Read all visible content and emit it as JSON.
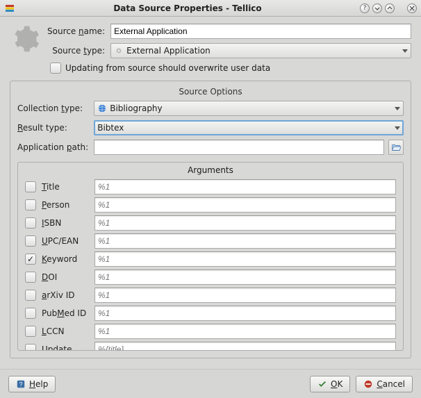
{
  "window": {
    "title": "Data Source Properties - Tellico"
  },
  "form": {
    "source_name": {
      "label": "Source name:",
      "access": "n",
      "value": "External Application"
    },
    "source_type": {
      "label": "Source type:",
      "access": "t",
      "value": "External Application"
    },
    "overwrite": {
      "label": "Updating from source should overwrite user data",
      "checked": false
    }
  },
  "options": {
    "title": "Source Options",
    "collection_type": {
      "label": "Collection type:",
      "access": "t",
      "value": "Bibliography"
    },
    "result_type": {
      "label": "Result type:",
      "access": "R",
      "value": "Bibtex"
    },
    "application_path": {
      "label": "Application path:",
      "access": "p",
      "value": ""
    }
  },
  "arguments": {
    "title": "Arguments",
    "rows": [
      {
        "label": "Title",
        "access": "T",
        "placeholder": "%1",
        "checked": false
      },
      {
        "label": "Person",
        "access": "P",
        "placeholder": "%1",
        "checked": false
      },
      {
        "label": "ISBN",
        "access": "I",
        "placeholder": "%1",
        "checked": false
      },
      {
        "label": "UPC/EAN",
        "access": "U",
        "placeholder": "%1",
        "checked": false
      },
      {
        "label": "Keyword",
        "access": "K",
        "placeholder": "%1",
        "checked": true
      },
      {
        "label": "DOI",
        "access": "D",
        "placeholder": "%1",
        "checked": false
      },
      {
        "label": "arXiv ID",
        "access": "a",
        "placeholder": "%1",
        "checked": false
      },
      {
        "label": "PubMed ID",
        "access": "M",
        "placeholder": "%1",
        "checked": false
      },
      {
        "label": "LCCN",
        "access": "L",
        "placeholder": "%1",
        "checked": false
      },
      {
        "label": "Update",
        "access": "e",
        "placeholder": "%{title}",
        "checked": false
      }
    ]
  },
  "buttons": {
    "help": "Help",
    "ok": "OK",
    "cancel": "Cancel"
  }
}
